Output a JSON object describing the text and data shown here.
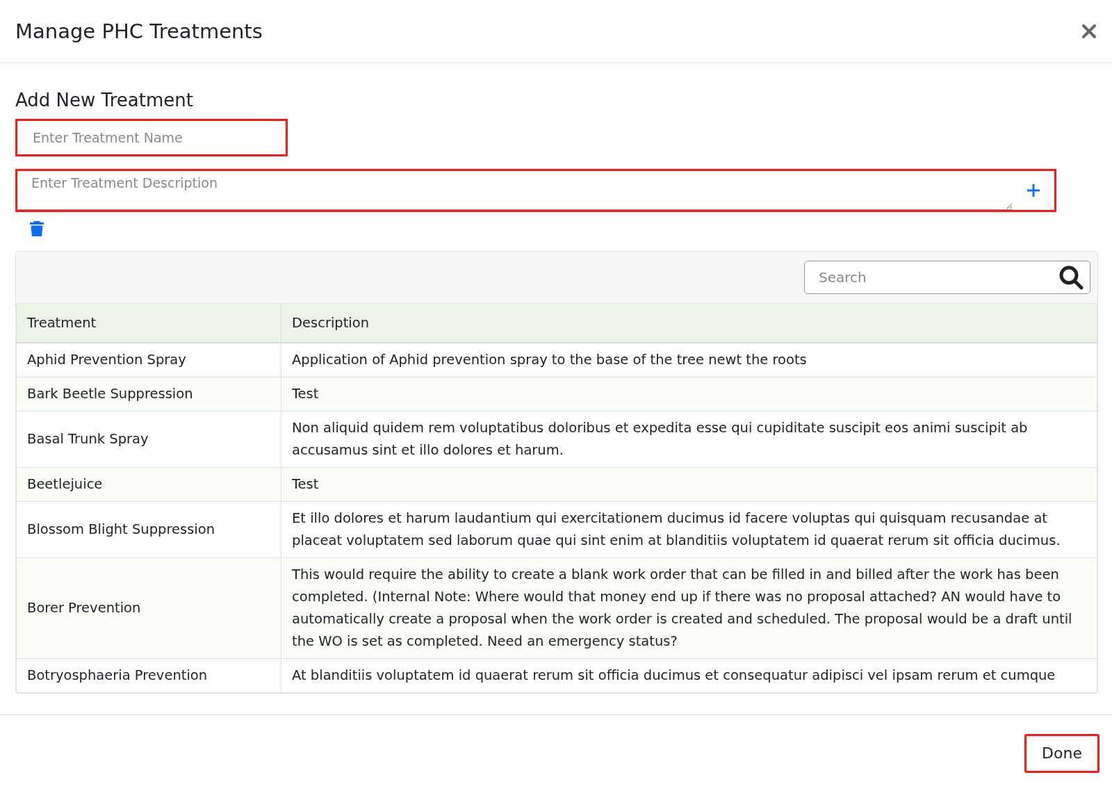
{
  "dialog": {
    "title": "Manage PHC Treatments"
  },
  "form": {
    "heading": "Add New Treatment",
    "name_field": {
      "placeholder": "Enter Treatment Name",
      "highlighted": true
    },
    "description_field": {
      "placeholder": "Enter Treatment Description",
      "highlighted": true
    }
  },
  "table": {
    "search": {
      "placeholder": "Search"
    },
    "columns": [
      "Treatment",
      "Description"
    ],
    "rows": [
      {
        "treatment": "Aphid Prevention Spray",
        "description": "Application of Aphid prevention spray to the base of the tree newt the roots"
      },
      {
        "treatment": "Bark Beetle Suppression",
        "description": "Test"
      },
      {
        "treatment": "Basal Trunk Spray",
        "description": "Non aliquid quidem rem voluptatibus doloribus et expedita esse qui cupiditate suscipit eos animi suscipit ab accusamus sint et illo dolores et harum."
      },
      {
        "treatment": "Beetlejuice",
        "description": "Test"
      },
      {
        "treatment": "Blossom Blight Suppression",
        "description": "Et illo dolores et harum laudantium qui exercitationem ducimus id facere voluptas qui quisquam recusandae at placeat voluptatem sed laborum quae qui sint enim at blanditiis voluptatem id quaerat rerum sit officia ducimus."
      },
      {
        "treatment": "Borer Prevention",
        "description": "This would require the ability to create a blank work order that can be filled in and billed after the work has been completed. (Internal Note: Where would that money end up if there was no proposal attached? AN would have to automatically create a proposal when the work order is created and scheduled. The proposal would be a draft until the WO is set as completed. Need an emergency status?"
      },
      {
        "treatment": "Botryosphaeria Prevention",
        "description": "At blanditiis voluptatem id quaerat rerum sit officia ducimus et consequatur adipisci vel ipsam rerum et cumque"
      }
    ]
  },
  "footer": {
    "done_button": {
      "label": "Done",
      "highlighted": true
    }
  }
}
